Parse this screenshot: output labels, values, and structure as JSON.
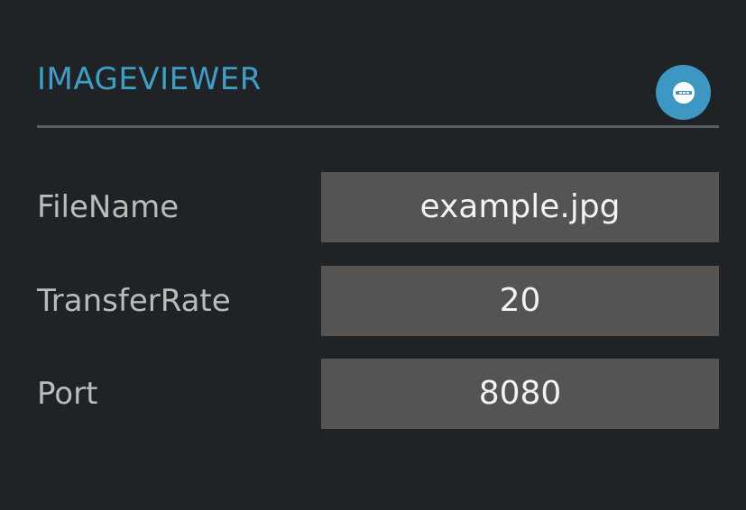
{
  "panel": {
    "title": "IMAGEVIEWER",
    "collapse_icon": "collapse-circle-icon",
    "accent_color": "#3f9ec7"
  },
  "fields": [
    {
      "label": "FileName",
      "value": "example.jpg"
    },
    {
      "label": "TransferRate",
      "value": "20"
    },
    {
      "label": "Port",
      "value": "8080"
    }
  ]
}
